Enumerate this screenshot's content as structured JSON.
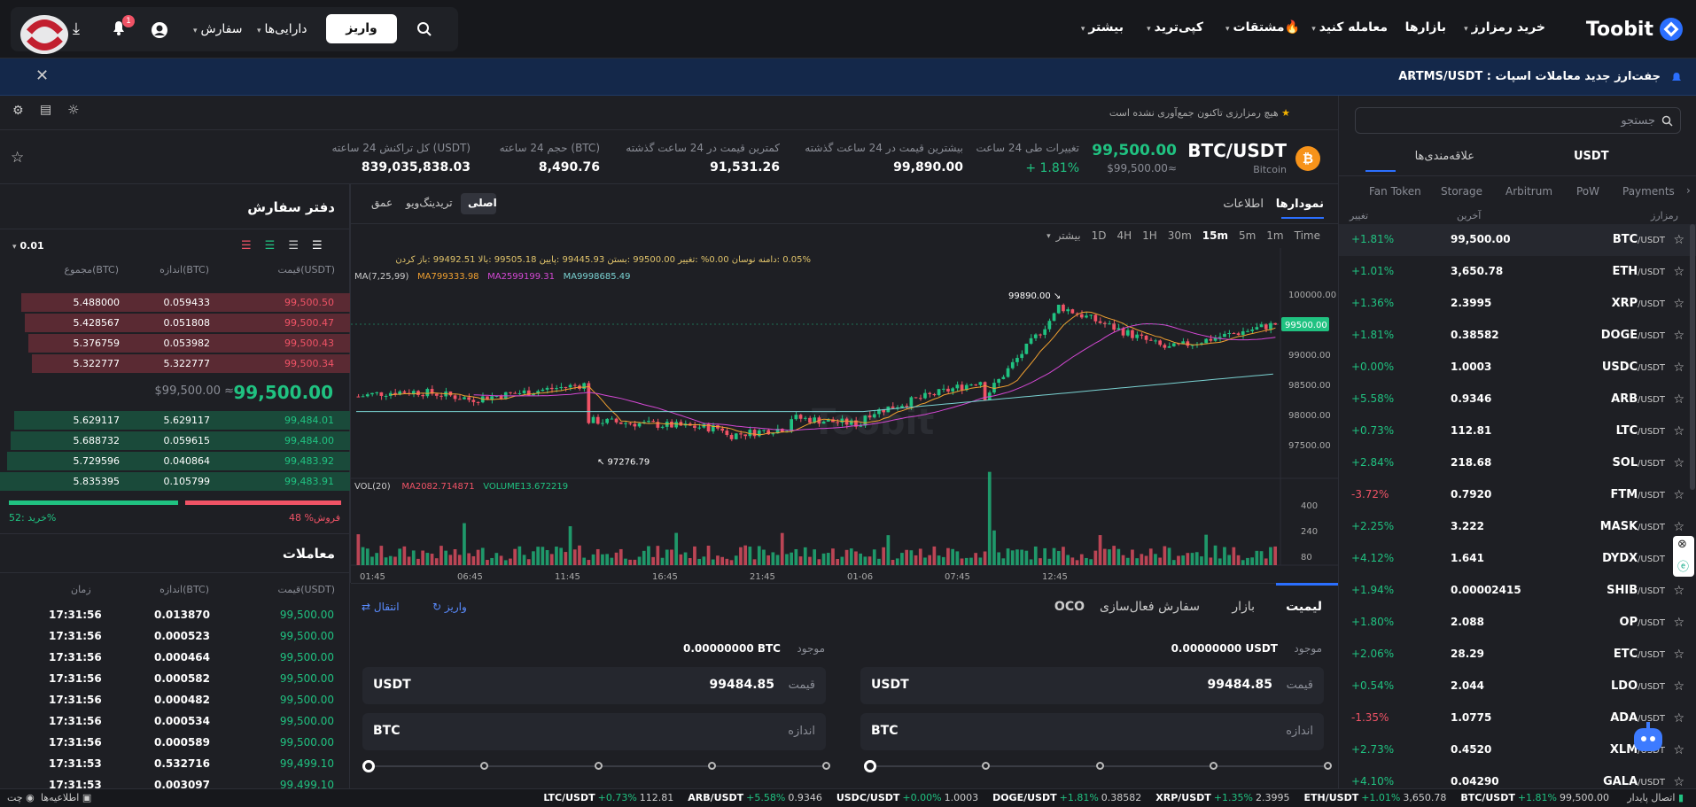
{
  "nav": {
    "brand": "Toobit",
    "items": [
      "خرید رمزارز",
      "بازارها",
      "معامله کنید",
      "مشتقات",
      "کپی‌ترید",
      "بیشتر"
    ],
    "deposit": "واریز",
    "assets": "دارایی‌ها",
    "orders": "سفارش",
    "notif_count": "1"
  },
  "banner": {
    "text": "جفت‌ارز جدید معاملات اسپات : ARTMS/USDT"
  },
  "search": {
    "placeholder": "جستجو"
  },
  "market": {
    "tabs": [
      "USDT",
      "علاقه‌مندی‌ها"
    ],
    "subtabs": [
      "Payments",
      "PoW",
      "Arbitrum",
      "Storage",
      "Fan Token"
    ],
    "headers": [
      "رمزارز",
      "آخرین",
      "تغییر"
    ],
    "rows": [
      {
        "base": "BTC",
        "quote": "/USDT",
        "price": "99,500.00",
        "change": "+1.81%",
        "up": true
      },
      {
        "base": "ETH",
        "quote": "/USDT",
        "price": "3,650.78",
        "change": "+1.01%",
        "up": true
      },
      {
        "base": "XRP",
        "quote": "/USDT",
        "price": "2.3995",
        "change": "+1.36%",
        "up": true
      },
      {
        "base": "DOGE",
        "quote": "/USDT",
        "price": "0.38582",
        "change": "+1.81%",
        "up": true
      },
      {
        "base": "USDC",
        "quote": "/USDT",
        "price": "1.0003",
        "change": "+0.00%",
        "up": true
      },
      {
        "base": "ARB",
        "quote": "/USDT",
        "price": "0.9346",
        "change": "+5.58%",
        "up": true
      },
      {
        "base": "LTC",
        "quote": "/USDT",
        "price": "112.81",
        "change": "+0.73%",
        "up": true
      },
      {
        "base": "SOL",
        "quote": "/USDT",
        "price": "218.68",
        "change": "+2.84%",
        "up": true
      },
      {
        "base": "FTM",
        "quote": "/USDT",
        "price": "0.7920",
        "change": "-3.72%",
        "up": false
      },
      {
        "base": "MASK",
        "quote": "/USDT",
        "price": "3.222",
        "change": "+2.25%",
        "up": true
      },
      {
        "base": "DYDX",
        "quote": "/USDT",
        "price": "1.641",
        "change": "+4.12%",
        "up": true
      },
      {
        "base": "SHIB",
        "quote": "/USDT",
        "price": "0.00002415",
        "change": "+1.94%",
        "up": true
      },
      {
        "base": "OP",
        "quote": "/USDT",
        "price": "2.088",
        "change": "+1.80%",
        "up": true
      },
      {
        "base": "ETC",
        "quote": "/USDT",
        "price": "28.29",
        "change": "+2.06%",
        "up": true
      },
      {
        "base": "LDO",
        "quote": "/USDT",
        "price": "2.044",
        "change": "+0.54%",
        "up": true
      },
      {
        "base": "ADA",
        "quote": "/USDT",
        "price": "1.0775",
        "change": "-1.35%",
        "up": false
      },
      {
        "base": "XLM",
        "quote": "/USDT",
        "price": "0.4520",
        "change": "+2.73%",
        "up": true
      },
      {
        "base": "GALA",
        "quote": "/USDT",
        "price": "0.04290",
        "change": "+4.10%",
        "up": true
      }
    ]
  },
  "favorites_note": "هیچ رمزارزی تاکنون جمع‌آوری نشده است",
  "ticker": {
    "pair": "BTC/USDT",
    "name": "Bitcoin",
    "price": "99,500.00",
    "price_sub": "$99,500.00≈",
    "change_label": "تغییرات طی 24 ساعت",
    "change": "+ 1.81%",
    "high_label": "بیشترین قیمت در 24 ساعت گذشته",
    "high": "99,890.00",
    "low_label": "کمترین قیمت در 24 ساعت گذشته",
    "low": "91,531.26",
    "vol_label": "حجم 24 ساعته (BTC)",
    "vol": "8,490.76",
    "turnover_label": "کل تراکنش 24 ساعته (USDT)",
    "turnover": "839,035,838.03"
  },
  "chart_tabs": {
    "charts": "نمودارها",
    "info": "اطلاعات",
    "views": [
      "اصلی",
      "تریدینگ‌ویو",
      "عمق"
    ]
  },
  "intervals": [
    "Time",
    "1m",
    "5m",
    "15m",
    "30m",
    "1H",
    "4H",
    "1D",
    "بیشتر"
  ],
  "indicators": {
    "line1": "0.05% :دامنه نوسان  0.00% :تغییر  99500.00 :بستن  99445.93 :پایین  99505.18 :بالا  99492.51 :باز کردن",
    "ma_label": "MA(7,25,99)",
    "ma7": "MA799333.98",
    "ma25": "MA2599199.31",
    "ma99": "MA9998685.49",
    "vol_label": "VOL(20)",
    "vol_ma": "MA2082.714871",
    "vol_val": "VOLUME13.672219"
  },
  "chart_data": {
    "type": "candlestick",
    "price_ticks": [
      "100000.00",
      "99500.00",
      "99000.00",
      "98500.00",
      "98000.00",
      "97500.00"
    ],
    "vol_ticks": [
      "400",
      "240",
      "80"
    ],
    "time_ticks": [
      "01:45",
      "06:45",
      "11:45",
      "16:45",
      "21:45",
      "01-06",
      "07:45",
      "12:45"
    ],
    "last_price": "99500.00",
    "high_marker": "99890.00",
    "low_marker": "97276.79",
    "ylim": [
      97276.79,
      99890.0
    ]
  },
  "orderbook": {
    "title": "دفتر سفارش",
    "precision": "0.01",
    "headers": [
      "قیمت(USDT)",
      "اندازه(BTC)",
      "مجموع(BTC)"
    ],
    "asks": [
      {
        "price": "99,500.50",
        "size": "0.059433",
        "total": "5.488000",
        "depth": 0.94
      },
      {
        "price": "99,500.47",
        "size": "0.051808",
        "total": "5.428567",
        "depth": 0.93
      },
      {
        "price": "99,500.43",
        "size": "0.053982",
        "total": "5.376759",
        "depth": 0.92
      },
      {
        "price": "99,500.34",
        "size": "5.322777",
        "total": "5.322777",
        "depth": 0.91
      }
    ],
    "mid_price": "99,500.00",
    "mid_sub": "$99,500.00 ≈",
    "bids": [
      {
        "price": "99,484.01",
        "size": "5.629117",
        "total": "5.629117",
        "depth": 0.96
      },
      {
        "price": "99,484.00",
        "size": "0.059615",
        "total": "5.688732",
        "depth": 0.97
      },
      {
        "price": "99,483.92",
        "size": "0.040864",
        "total": "5.729596",
        "depth": 0.98
      },
      {
        "price": "99,483.91",
        "size": "0.105799",
        "total": "5.835395",
        "depth": 1.0
      }
    ],
    "sell_pct": "48",
    "sell_label": "فروش%",
    "buy_pct": "52:",
    "buy_label": "خرید%",
    "buy_ratio": 0.52
  },
  "trades": {
    "title": "معاملات",
    "headers": [
      "قیمت(USDT)",
      "اندازه(BTC)",
      "زمان"
    ],
    "rows": [
      {
        "price": "99,500.00",
        "size": "0.013870",
        "time": "17:31:56"
      },
      {
        "price": "99,500.00",
        "size": "0.000523",
        "time": "17:31:56"
      },
      {
        "price": "99,500.00",
        "size": "0.000464",
        "time": "17:31:56"
      },
      {
        "price": "99,500.00",
        "size": "0.000582",
        "time": "17:31:56"
      },
      {
        "price": "99,500.00",
        "size": "0.000482",
        "time": "17:31:56"
      },
      {
        "price": "99,500.00",
        "size": "0.000534",
        "time": "17:31:56"
      },
      {
        "price": "99,500.00",
        "size": "0.000589",
        "time": "17:31:56"
      },
      {
        "price": "99,499.10",
        "size": "0.532716",
        "time": "17:31:53"
      },
      {
        "price": "99,499.10",
        "size": "0.003097",
        "time": "17:31:53"
      }
    ]
  },
  "orderform": {
    "tabs": [
      "لیمیت",
      "بازار",
      "سفارش فعال‌سازی",
      "OCO"
    ],
    "deposit": "واریز",
    "transfer": "انتقال",
    "buy_avail_label": "موجود",
    "buy_avail": "0.00000000 USDT",
    "sell_avail_label": "موجود",
    "sell_avail": "0.00000000 BTC",
    "price_label": "قیمت",
    "price_value": "99484.85",
    "price_unit": "USDT",
    "size_label": "اندازه",
    "size_unit": "BTC"
  },
  "bottom_ticker": {
    "status": "اتصال پایدار",
    "items": [
      {
        "pair": "BTC/USDT",
        "change": "+1.81%",
        "price": "99,500.00"
      },
      {
        "pair": "ETH/USDT",
        "change": "+1.01%",
        "price": "3,650.78"
      },
      {
        "pair": "XRP/USDT",
        "change": "+1.35%",
        "price": "2.3995"
      },
      {
        "pair": "DOGE/USDT",
        "change": "+1.81%",
        "price": "0.38582"
      },
      {
        "pair": "USDC/USDT",
        "change": "+0.00%",
        "price": "1.0003"
      },
      {
        "pair": "ARB/USDT",
        "change": "+5.58%",
        "price": "0.9346"
      },
      {
        "pair": "LTC/USDT",
        "change": "+0.73%",
        "price": "112.81"
      }
    ],
    "announcements": "اطلاعیه‌ها",
    "chat": "چت"
  },
  "colors": {
    "up": "#20c281",
    "down": "#f05366",
    "accent": "#2b6fff"
  }
}
